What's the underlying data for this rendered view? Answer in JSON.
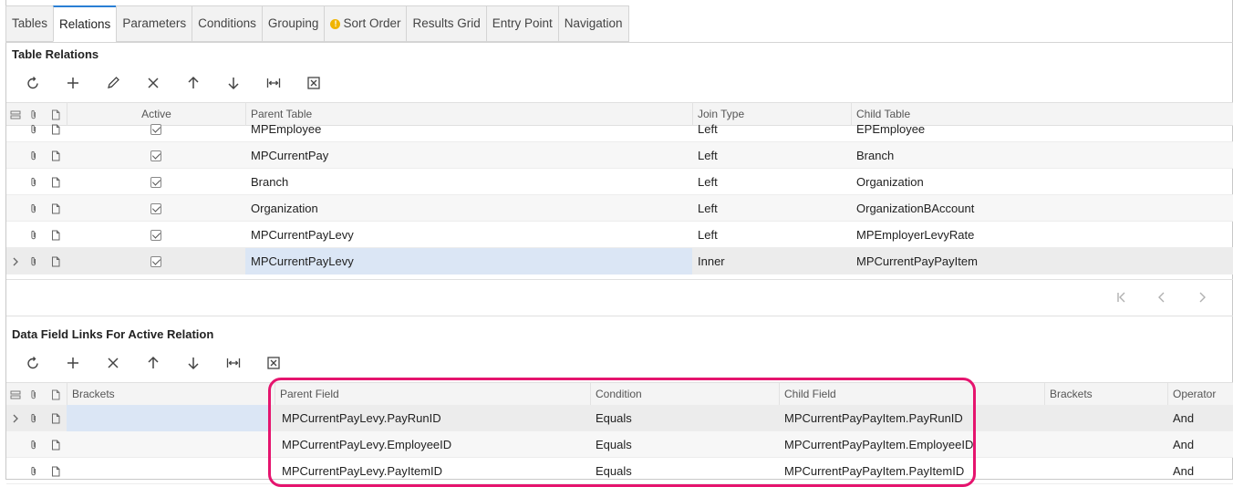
{
  "tabs": [
    {
      "label": "Tables",
      "active": false,
      "warning": false
    },
    {
      "label": "Relations",
      "active": true,
      "warning": false
    },
    {
      "label": "Parameters",
      "active": false,
      "warning": false
    },
    {
      "label": "Conditions",
      "active": false,
      "warning": false
    },
    {
      "label": "Grouping",
      "active": false,
      "warning": false
    },
    {
      "label": "Sort Order",
      "active": false,
      "warning": true
    },
    {
      "label": "Results Grid",
      "active": false,
      "warning": false
    },
    {
      "label": "Entry Point",
      "active": false,
      "warning": false
    },
    {
      "label": "Navigation",
      "active": false,
      "warning": false
    }
  ],
  "relations": {
    "title": "Table Relations",
    "toolbar": [
      "refresh-icon",
      "add-icon",
      "edit-icon",
      "delete-icon",
      "move-up-icon",
      "move-down-icon",
      "fit-width-icon",
      "export-excel-icon"
    ],
    "columns": {
      "active": "Active",
      "parent_table": "Parent Table",
      "join_type": "Join Type",
      "child_table": "Child Table"
    },
    "rows": [
      {
        "active": true,
        "parent": "MPEmployee",
        "join": "Left",
        "child": "EPEmployee"
      },
      {
        "active": true,
        "parent": "MPCurrentPay",
        "join": "Left",
        "child": "Branch"
      },
      {
        "active": true,
        "parent": "Branch",
        "join": "Left",
        "child": "Organization"
      },
      {
        "active": true,
        "parent": "Organization",
        "join": "Left",
        "child": "OrganizationBAccount"
      },
      {
        "active": true,
        "parent": "MPCurrentPayLevy",
        "join": "Left",
        "child": "MPEmployerLevyRate"
      },
      {
        "active": true,
        "parent": "MPCurrentPayLevy",
        "join": "Inner",
        "child": "MPCurrentPayPayItem"
      }
    ],
    "selected_row": 5,
    "pager": [
      "first-page-icon",
      "prev-page-icon",
      "next-page-icon"
    ]
  },
  "links": {
    "title": "Data Field Links For Active Relation",
    "toolbar": [
      "refresh-icon",
      "add-icon",
      "delete-icon",
      "move-up-icon",
      "move-down-icon",
      "fit-width-icon",
      "export-excel-icon"
    ],
    "columns": {
      "brackets_open": "Brackets",
      "parent_field": "Parent Field",
      "condition": "Condition",
      "child_field": "Child Field",
      "brackets_close": "Brackets",
      "operator": "Operator"
    },
    "rows": [
      {
        "brackets_open": "",
        "parent": "MPCurrentPayLevy.PayRunID",
        "condition": "Equals",
        "child": "MPCurrentPayPayItem.PayRunID",
        "brackets_close": "",
        "operator": "And"
      },
      {
        "brackets_open": "",
        "parent": "MPCurrentPayLevy.EmployeeID",
        "condition": "Equals",
        "child": "MPCurrentPayPayItem.EmployeeID",
        "brackets_close": "",
        "operator": "And"
      },
      {
        "brackets_open": "",
        "parent": "MPCurrentPayLevy.PayItemID",
        "condition": "Equals",
        "child": "MPCurrentPayPayItem.PayItemID",
        "brackets_close": "",
        "operator": "And"
      }
    ],
    "selected_row": 0
  },
  "colors": {
    "accent": "#2a7fd4",
    "highlight": "#e5146e",
    "selected_cell": "#dbe6f5"
  }
}
